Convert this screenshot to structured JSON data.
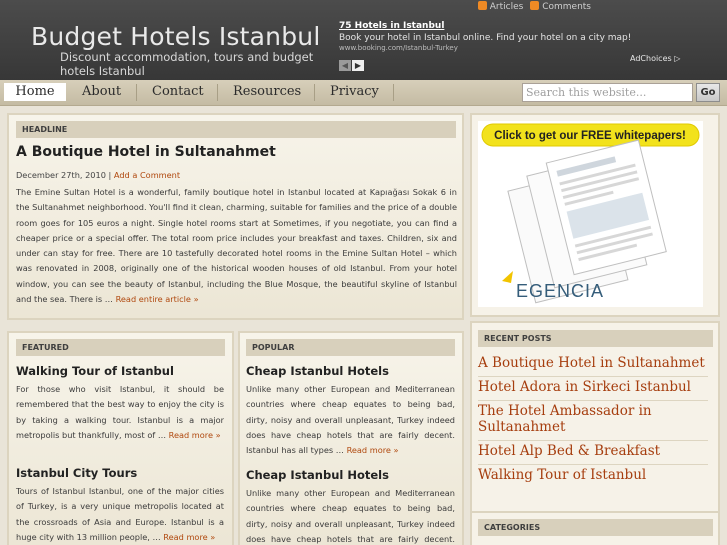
{
  "header": {
    "site_title": "Budget Hotels Istanbul",
    "site_description": "Discount accommodation, tours and budget hotels Istanbul",
    "feeds": {
      "articles": "Articles",
      "comments": "Comments"
    }
  },
  "ad": {
    "title": "75 Hotels in Istanbul",
    "text": "Book your hotel in Istanbul online. Find your hotel on a city map!",
    "url": "www.booking.com/Istanbul-Turkey",
    "adchoices": "AdChoices"
  },
  "nav": {
    "items": [
      "Home",
      "About",
      "Contact",
      "Resources",
      "Privacy"
    ],
    "search_placeholder": "Search this website...",
    "search_button": "Go"
  },
  "headline": {
    "label": "HEADLINE",
    "title": "A Boutique Hotel in Sultanahmet",
    "date": "December 27th, 2010",
    "comment_link": "Add a Comment",
    "body": "The Emine Sultan Hotel is a wonderful, family boutique hotel in Istanbul located at Kapıağası Sokak 6 in the Sultanahmet neighborhood.  You'll find it clean, charming, suitable for families and the price of a double room goes for 105 euros a night. Single hotel rooms start at Sometimes, if you negotiate, you can find a cheaper price or a special offer.  The total room price includes your breakfast and taxes.  Children, six and under can stay for free. There are 10 tastefully decorated hotel rooms in the Emine Sultan Hotel – which was renovated in 2008, originally one of the historical wooden houses of old Istanbul. From your hotel window, you can see the beauty of Istanbul, including the Blue Mosque, the beautiful skyline of Istanbul and the sea. There is …",
    "more": "Read entire article »"
  },
  "featured": {
    "label": "FEATURED",
    "posts": [
      {
        "title": "Walking Tour of Istanbul",
        "body": "For those who visit Istanbul, it should be remembered that the best way to enjoy the city is by taking a walking tour. Istanbul is a major metropolis but thankfully, most of …",
        "more": "Read more »"
      },
      {
        "title": "Istanbul City Tours",
        "body": "Tours of Istanbul Istanbul, one of the major cities of Turkey, is a very unique metropolis located at the crossroads of Asia and Europe. Istanbul is a huge city with 13 million people, …",
        "more": "Read more »"
      }
    ]
  },
  "popular": {
    "label": "POPULAR",
    "posts": [
      {
        "title": "Cheap Istanbul Hotels",
        "body": "Unlike many other European and Mediterranean countries where cheap equates to being bad, dirty, noisy and overall unpleasant, Turkey indeed does have cheap hotels that are fairly decent. Istanbul has all types …",
        "more": "Read more »"
      },
      {
        "title": "Cheap Istanbul Hotels",
        "body": "Unlike many other European and Mediterranean countries where cheap equates to being bad, dirty, noisy and overall unpleasant, Turkey indeed does have cheap hotels that are fairly decent. Istanbul",
        "more": ""
      }
    ]
  },
  "sidebar": {
    "banner": {
      "headline": "Click to get our FREE whitepapers!",
      "brand": "EGENCIA"
    },
    "recent_label": "RECENT POSTS",
    "recent_posts": [
      "A Boutique Hotel in Sultanahmet",
      "Hotel Adora in Sirkeci Istanbul",
      "The Hotel Ambassador in Sultanahmet",
      "Hotel Alp Bed & Breakfast",
      "Walking Tour of Istanbul"
    ],
    "categories_label": "CATEGORIES"
  },
  "colors": {
    "header_bg": "#3f3f3f",
    "nav_bg": "#cfc7b0",
    "content_bg": "#f4f0e4",
    "link": "#b0490f",
    "sidebar_link": "#a63e0f",
    "banner_yellow": "#f2e21c"
  }
}
